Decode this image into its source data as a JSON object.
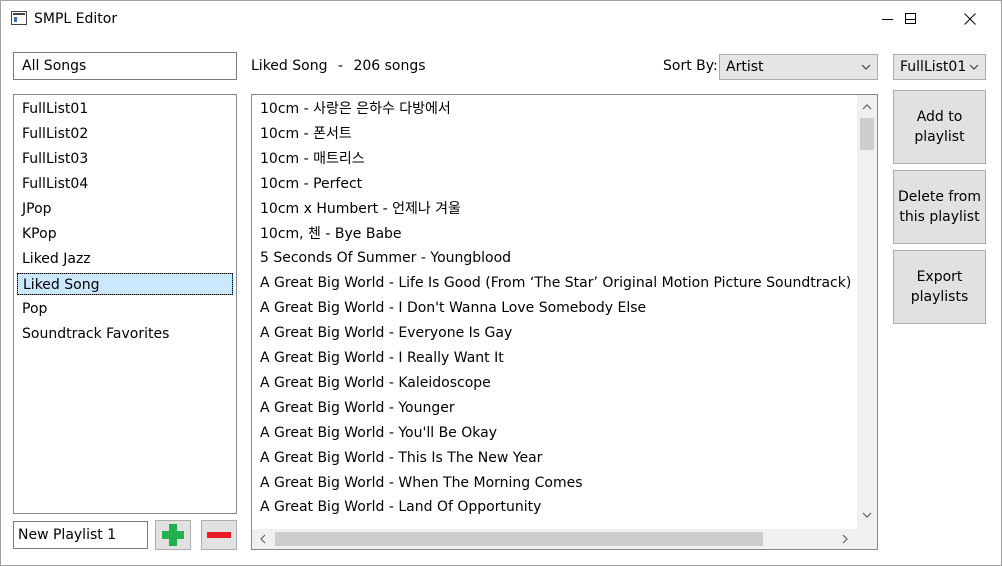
{
  "window": {
    "title": "SMPL Editor"
  },
  "colors": {
    "selection_bg": "#cce8ff",
    "add_green": "#22b14c",
    "remove_red": "#ed1c24"
  },
  "left": {
    "filter_value": "All Songs",
    "playlists": [
      "FullList01",
      "FullList02",
      "FullList03",
      "FullList04",
      "JPop",
      "KPop",
      "Liked Jazz",
      "Liked Song",
      "Pop",
      "Soundtrack Favorites"
    ],
    "selected_playlist": "Liked Song",
    "new_playlist_value": "New Playlist 1",
    "add_icon": "plus-icon",
    "remove_icon": "minus-icon"
  },
  "center": {
    "header_playlist": "Liked Song",
    "header_sep": "-",
    "header_count": "206 songs",
    "sort_label": "Sort By:",
    "sort_value": "Artist",
    "songs": [
      "10cm  -  사랑은 은하수 다방에서",
      "10cm  -  폰서트",
      "10cm  -  매트리스",
      "10cm  -  Perfect",
      "10cm x Humbert  -  언제나 겨울",
      "10cm, 첸  -  Bye Babe",
      "5 Seconds Of Summer  -  Youngblood",
      "A Great Big World  -  Life Is Good (From ‘The Star’ Original Motion Picture Soundtrack) (영화",
      "A Great Big World  -  I Don't Wanna Love Somebody Else",
      "A Great Big World  -  Everyone Is Gay",
      "A Great Big World  -  I Really Want It",
      "A Great Big World  -  Kaleidoscope",
      "A Great Big World  -  Younger",
      "A Great Big World  -  You'll Be Okay",
      "A Great Big World  -  This Is The New Year",
      "A Great Big World  -  When The Morning Comes",
      "A Great Big World  -  Land Of Opportunity"
    ]
  },
  "right": {
    "target_playlist": "FullList01",
    "add_btn": [
      "Add to",
      "playlist"
    ],
    "delete_btn": [
      "Delete from",
      "this playlist"
    ],
    "export_btn": [
      "Export",
      "playlists"
    ]
  }
}
